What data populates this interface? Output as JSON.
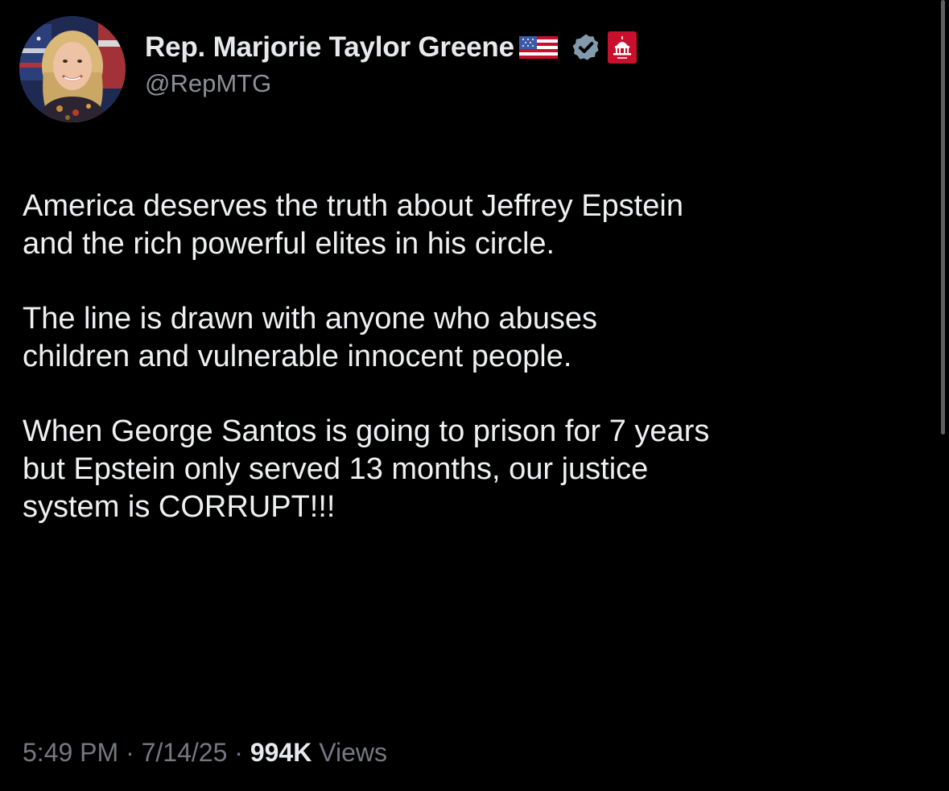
{
  "author": {
    "display_name": "Rep. Marjorie Taylor Greene",
    "handle": "@RepMTG",
    "icons": [
      "us-flag-icon",
      "verified-badge-icon",
      "government-affiliation-icon"
    ]
  },
  "post": {
    "paragraphs": [
      "America deserves the truth about Jeffrey Epstein\nand the rich powerful elites in his circle.",
      "The line is drawn with anyone who abuses\nchildren and vulnerable innocent people.",
      "When George Santos is going to prison for 7 years\nbut Epstein only served 13 months, our justice\nsystem is CORRUPT!!!"
    ]
  },
  "meta": {
    "time": "5:49 PM",
    "separator": " · ",
    "date": "7/14/25",
    "views_count": "994K",
    "views_label": " Views"
  },
  "colors": {
    "background": "#000000",
    "text": "#e7e9ea",
    "secondary": "#8b9095",
    "verified": "#829aab",
    "gov_badge": "#c8102e"
  }
}
